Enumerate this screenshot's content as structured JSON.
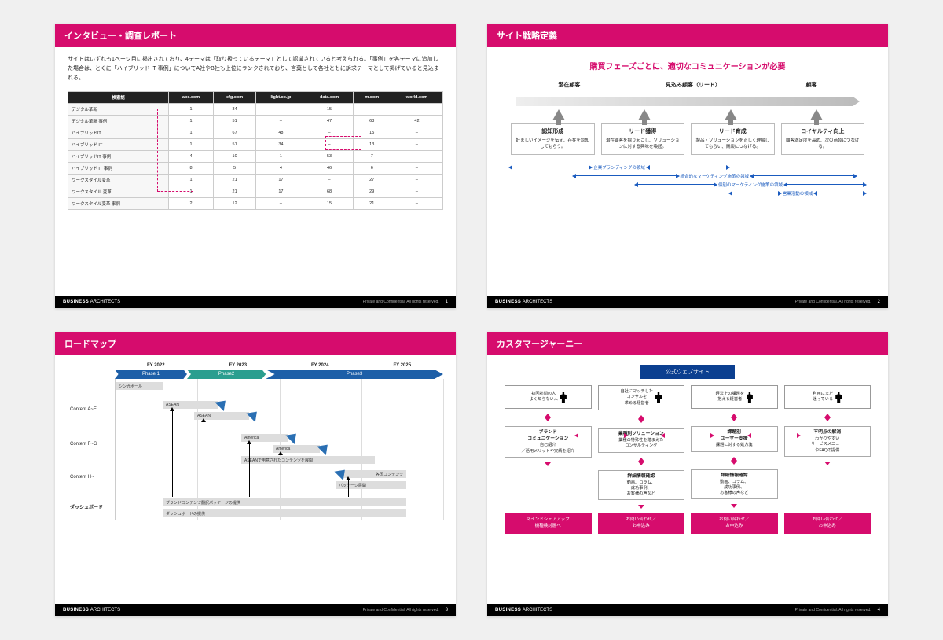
{
  "footer": {
    "brand_b": "BUSINESS",
    "brand_t": "ARCHITECTS",
    "conf": "Private and Confidential. All rights reserved."
  },
  "s1": {
    "title": "インタビュー・調査レポート",
    "intro": "サイトはいずれも1ページ目に掲出されており、4テーマは「取り扱っているテーマ」として認識されていると考えられる。「事例」を各テーマに追加した場合は、とくに「ハイブリッド IT 事例」についてA社やB社も上位にランクされており、言葉として各社ともに訴求テーマとして掲げていると見込まれる。",
    "cols": [
      "検索語",
      "abc.com",
      "efg.com",
      "light.co.jp",
      "data.com",
      "m.com",
      "world.com"
    ],
    "rows": [
      [
        "デジタル革新",
        "1",
        "34",
        "–",
        "15",
        "–",
        "–"
      ],
      [
        "デジタル革新 事例",
        "1",
        "51",
        "–",
        "47",
        "63",
        "42"
      ],
      [
        "ハイブリッドIT",
        "1",
        "67",
        "48",
        "–",
        "15",
        "–"
      ],
      [
        "ハイブリッド IT",
        "1",
        "51",
        "34",
        "–",
        "13",
        "–"
      ],
      [
        "ハイブリッドIT 事例",
        "4",
        "10",
        "1",
        "53",
        "7",
        "–"
      ],
      [
        "ハイブリッド IT 事例",
        "8",
        "5",
        "4",
        "46",
        "6",
        "–"
      ],
      [
        "ワークスタイル変革",
        "1",
        "21",
        "17",
        "–",
        "27",
        "–"
      ],
      [
        "ワークスタイル 変革",
        "1",
        "21",
        "17",
        "68",
        "29",
        "–"
      ],
      [
        "ワークスタイル変革 事例",
        "2",
        "12",
        "–",
        "15",
        "21",
        "–"
      ]
    ],
    "page": "1"
  },
  "s2": {
    "title": "サイト戦略定義",
    "headline": "購買フェーズごとに、適切なコミュニケーションが必要",
    "phases": [
      "潜在顧客",
      "見込み顧客（リード）",
      "顧客"
    ],
    "cards": [
      {
        "t": "認知形成",
        "d": "好ましいイメージを伝え、存在を認知してもらう。"
      },
      {
        "t": "リード獲得",
        "d": "潜在顧客を掘り起こし、ソリューションに対する興味を喚起。"
      },
      {
        "t": "リード育成",
        "d": "製品・ソリューションを正しく理解してもらい、商談につなげる。"
      },
      {
        "t": "ロイヤルティ向上",
        "d": "顧客満足度を高め、次の商談につなげる。"
      }
    ],
    "ranges": [
      "企業ブランディングの領域",
      "統合的なマーケティング施策の領域",
      "個別のマーケティング施策の領域",
      "営業活動の領域"
    ],
    "page": "2"
  },
  "s3": {
    "title": "ロードマップ",
    "fy": [
      "FY 2022",
      "FY 2023",
      "FY 2024",
      "FY 2025"
    ],
    "phases": [
      {
        "label": "Phase 1",
        "color": "#1d5fa8",
        "w": 22
      },
      {
        "label": "Phase2",
        "color": "#2a9e8f",
        "w": 24
      },
      {
        "label": "Phase3",
        "color": "#1d5fa8",
        "w": 54
      }
    ],
    "rows": [
      "Content A~E",
      "Content F~G",
      "Content H~",
      "ダッシュボード"
    ],
    "bars": {
      "singapore": "シンガポール",
      "asean": "ASEAN",
      "america": "America",
      "asean_expand": "ASEANで用意されたコンテンツを展開",
      "kakkoku": "各国コンテンツ",
      "package": "パッケージ展開",
      "brand_pkg": "ブランドコンテンツ翻訳パッケージの提供",
      "dash": "ダッシュボードの提供"
    },
    "page": "3"
  },
  "s4": {
    "title": "カスタマージャーニー",
    "hub": "公式ウェブサイト",
    "cols": [
      {
        "persona": "初回訪問の人\nよく知らない人",
        "b1t": "ブランド\nコミュニケーション",
        "b1d": "自己紹介\n／活用メリットや実績を紹介",
        "cta": "マインドシェアアップ\n機種検討層へ"
      },
      {
        "persona": "自社にマッチした\nコンサルを\n求める経営者",
        "b1t": "業種別ソリューション",
        "b1d": "業種の特殊性を踏まえた\nコンサルティング",
        "b2t": "詳細情報確認",
        "b2d": "動画、コラム、\n成功事例、\nお客様の声など",
        "cta": "お問い合わせ／\nお申込み"
      },
      {
        "persona": "経営上の課題を\n抱える経営者",
        "b1t": "課題別\nユーザー支援",
        "b1d": "課題に対する処方箋",
        "b2t": "詳細情報確認",
        "b2d": "動画、コラム、\n成功事例、\nお客様の声など",
        "cta": "お問い合わせ／\nお申込み"
      },
      {
        "persona": "利用にまだ\n迷っている",
        "b1t": "不明点の解消",
        "b1d": "わかりやすい\nサービスメニュー\nやFAQの提供",
        "cta": "お問い合わせ／\nお申込み"
      }
    ],
    "page": "4"
  }
}
